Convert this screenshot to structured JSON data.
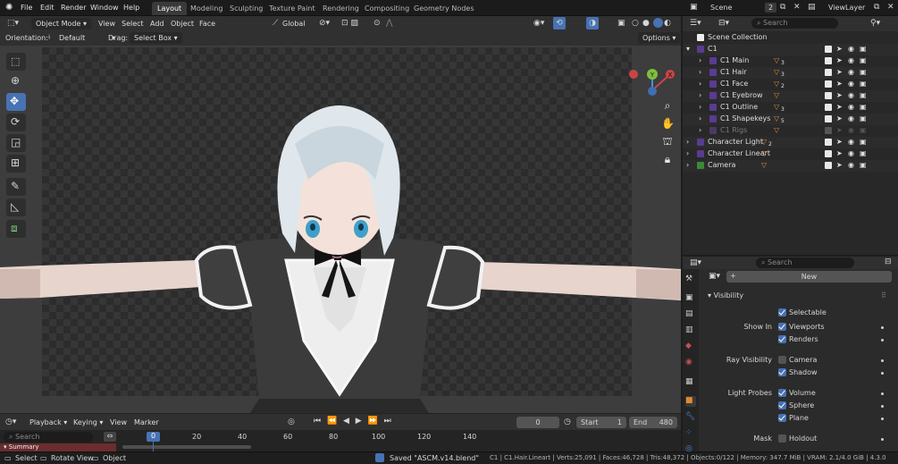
{
  "menu": [
    "File",
    "Edit",
    "Render",
    "Window",
    "Help"
  ],
  "workspaces": [
    "Layout",
    "Modeling",
    "Sculpting",
    "Texture Paint",
    "Rendering",
    "Compositing",
    "Geometry Nodes"
  ],
  "scene": {
    "name": "Scene",
    "count": "2",
    "view_layer": "ViewLayer"
  },
  "viewport_header": {
    "mode": "Object Mode",
    "menus": [
      "View",
      "Select",
      "Add",
      "Object",
      "Face"
    ],
    "transform": "Global",
    "orientation_label": "Orientation:",
    "orientation_value": "Default",
    "drag_label": "Drag:",
    "drag_value": "Select Box",
    "options": "Options"
  },
  "gizmo": {
    "x": "X",
    "y": "Y",
    "z": "Z"
  },
  "outliner": {
    "search_placeholder": "Search",
    "root": "Scene Collection",
    "items": [
      {
        "name": "C1",
        "level": 1
      },
      {
        "name": "C1 Main",
        "level": 2,
        "suffix": "3"
      },
      {
        "name": "C1 Hair",
        "level": 2,
        "suffix": "3"
      },
      {
        "name": "C1 Face",
        "level": 2,
        "suffix": "2"
      },
      {
        "name": "C1 Eyebrow",
        "level": 2,
        "suffix": ""
      },
      {
        "name": "C1 Outline",
        "level": 2,
        "suffix": "3"
      },
      {
        "name": "C1 Shapekeys",
        "level": 2,
        "suffix": "5"
      },
      {
        "name": "C1 Rigs",
        "level": 2,
        "suffix": ""
      },
      {
        "name": "Character Light",
        "level": 1,
        "suffix": "2"
      },
      {
        "name": "Character Lineart",
        "level": 1,
        "suffix": ""
      },
      {
        "name": "Camera",
        "level": 1,
        "suffix": ""
      }
    ]
  },
  "properties": {
    "search_placeholder": "Search",
    "new_button": "New",
    "panel": "Visibility",
    "selectable": "Selectable",
    "show_in_label": "Show In",
    "viewports": "Viewports",
    "renders": "Renders",
    "ray_visibility_label": "Ray Visibility",
    "camera": "Camera",
    "shadow": "Shadow",
    "light_probes_label": "Light Probes",
    "volume": "Volume",
    "sphere": "Sphere",
    "plane": "Plane",
    "mask_label": "Mask",
    "holdout": "Holdout"
  },
  "timeline": {
    "menus": [
      "Playback",
      "Keying",
      "View",
      "Marker"
    ],
    "current_frame": "0",
    "start_label": "Start",
    "start": "1",
    "end_label": "End",
    "end": "480",
    "ruler": [
      "0",
      "20",
      "40",
      "60",
      "80",
      "100",
      "120",
      "140"
    ],
    "search_placeholder": "Search",
    "summary": "Summary"
  },
  "statusbar": {
    "select": "Select",
    "rotate": "Rotate View",
    "object": "Object",
    "saved": "Saved \"ASCM.v14.blend\"",
    "stats": "C1 | C1.Hair.Lineart | Verts:25,091 | Faces:46,728 | Tris:48,372 | Objects:0/122 | Memory: 347.7 MiB | VRAM: 2.1/4.0 GiB | 4.3.0"
  }
}
